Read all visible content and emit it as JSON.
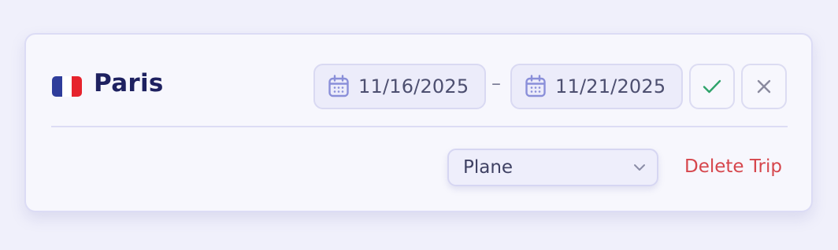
{
  "trip": {
    "city": "Paris",
    "flag_colors": [
      "#2f3d9b",
      "#ffffff",
      "#e6232d"
    ],
    "start_date": "11/16/2025",
    "separator": "–",
    "end_date": "11/21/2025"
  },
  "transport": {
    "selected": "Plane"
  },
  "actions": {
    "delete_label": "Delete Trip"
  },
  "icons": {
    "start_date": "calendar-icon",
    "end_date": "calendar-icon",
    "confirm": "check-icon",
    "cancel": "close-icon",
    "dropdown": "chevron-down-icon"
  },
  "colors": {
    "title": "#1e2160",
    "confirm": "#2fa36b",
    "cancel": "#8a8a9e",
    "delete": "#d6464c",
    "calendar": "#8a8fd9"
  }
}
